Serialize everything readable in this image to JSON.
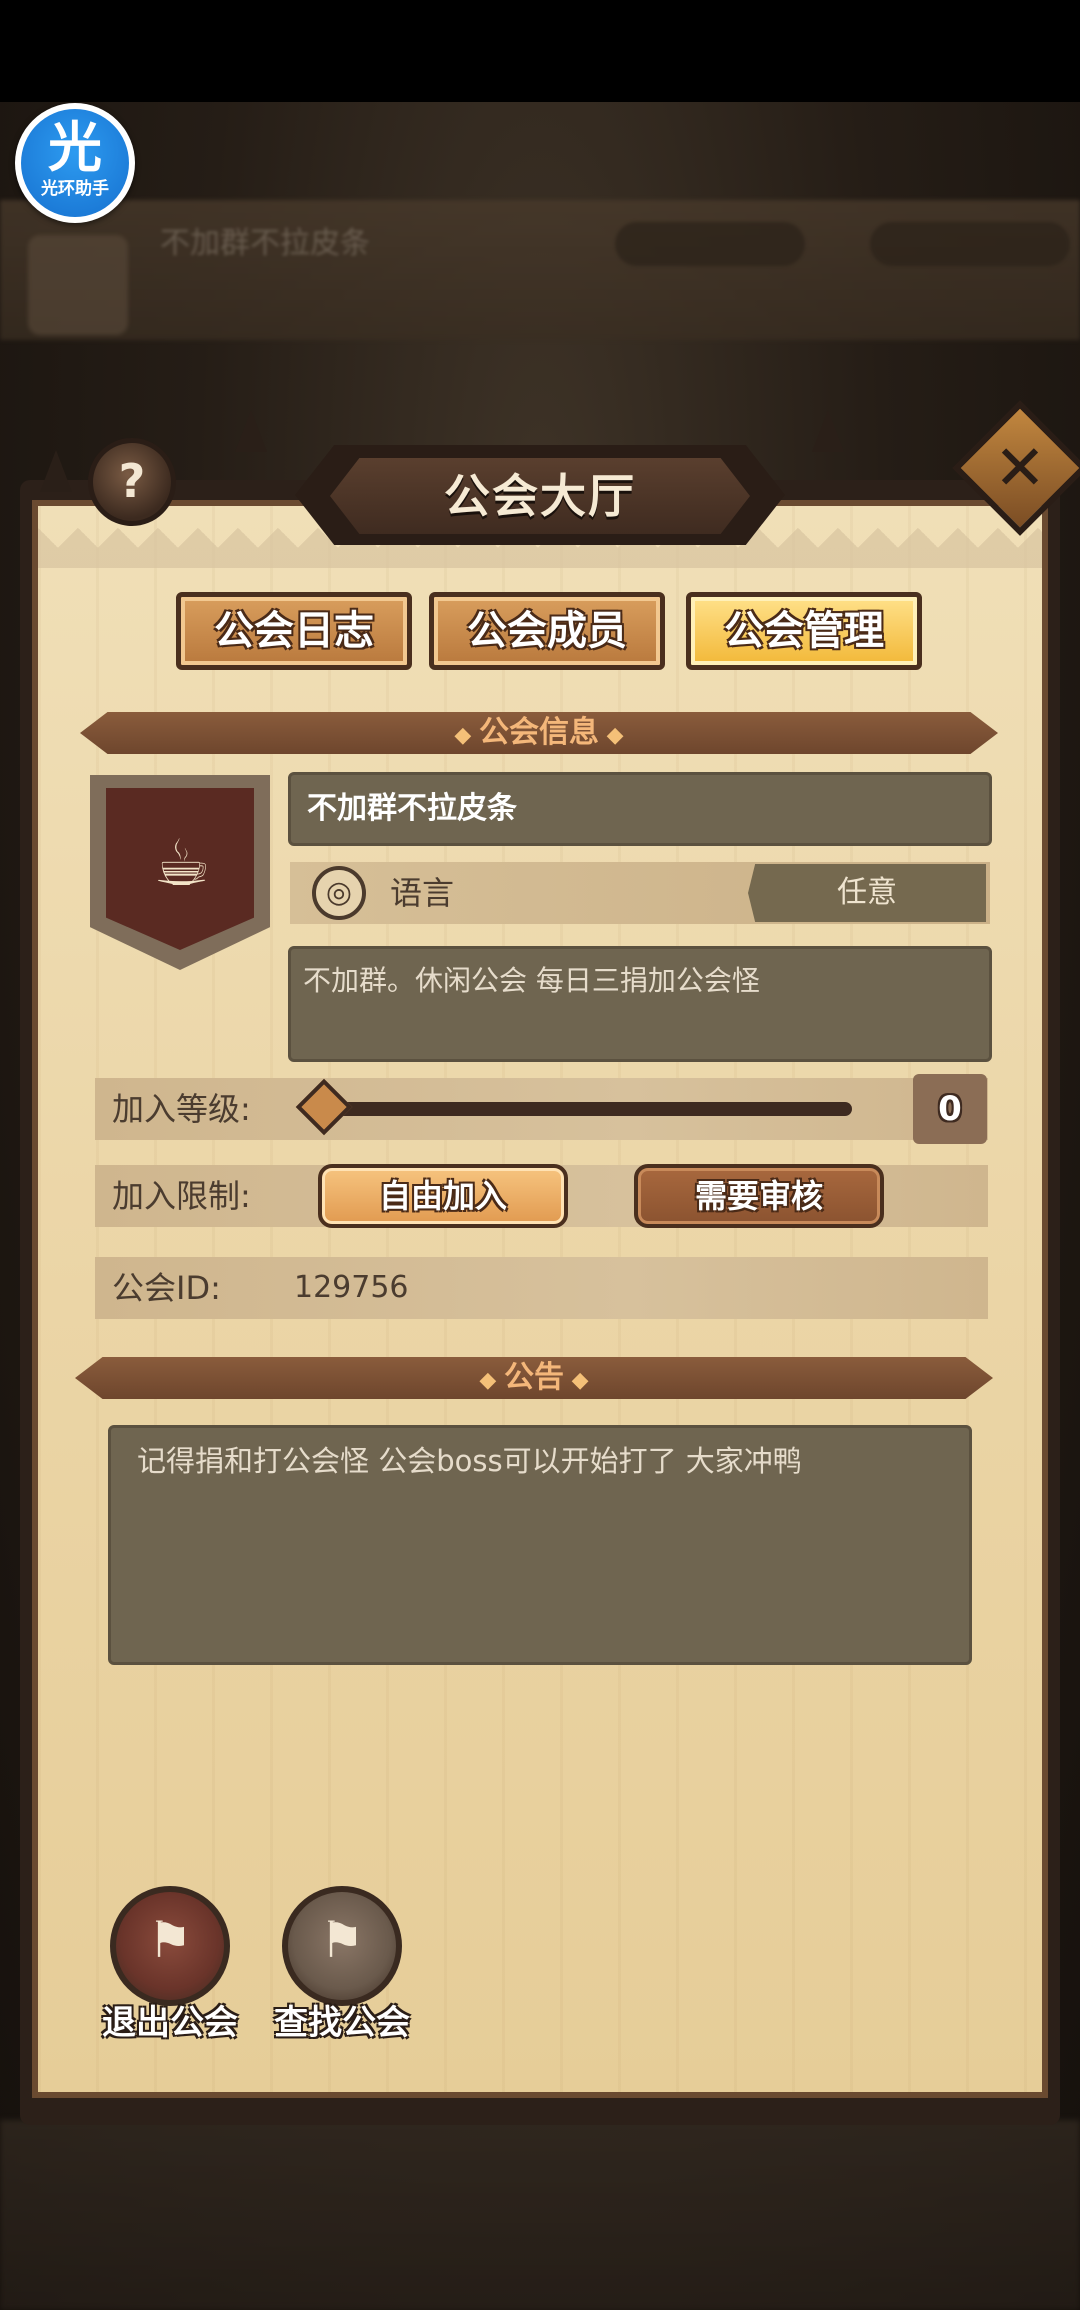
{
  "helper": {
    "char": "光",
    "label": "光环助手"
  },
  "background": {
    "guild_title": "不加群不拉皮条"
  },
  "dialog": {
    "title": "公会大厅",
    "help_label": "?",
    "close_label": "✕"
  },
  "tabs": [
    {
      "label": "公会日志",
      "active": false
    },
    {
      "label": "公会成员",
      "active": false
    },
    {
      "label": "公会管理",
      "active": true
    }
  ],
  "info_section": {
    "header": "公会信息",
    "emblem_icon": "beer-mug-icon",
    "guild_name": "不加群不拉皮条",
    "language_label": "语言",
    "language_value": "任意",
    "description": "不加群。休闲公会 每日三捐加公会怪",
    "level_label": "加入等级:",
    "level_value": "0",
    "limit_label": "加入限制:",
    "limit_options": [
      "自由加入",
      "需要审核"
    ],
    "limit_selected": "自由加入",
    "id_label": "公会ID:",
    "id_value": "129756"
  },
  "notice_section": {
    "header": "公告",
    "text": "记得捐和打公会怪 公会boss可以开始打了 大家冲鸭"
  },
  "actions": {
    "leave_label": "退出公会",
    "find_label": "查找公会"
  },
  "colors": {
    "parchment": "#ebd5a6",
    "frame": "#2c2019",
    "accent_gold": "#f2b838",
    "section_bar": "#7a5034",
    "field": "#6f6550"
  }
}
